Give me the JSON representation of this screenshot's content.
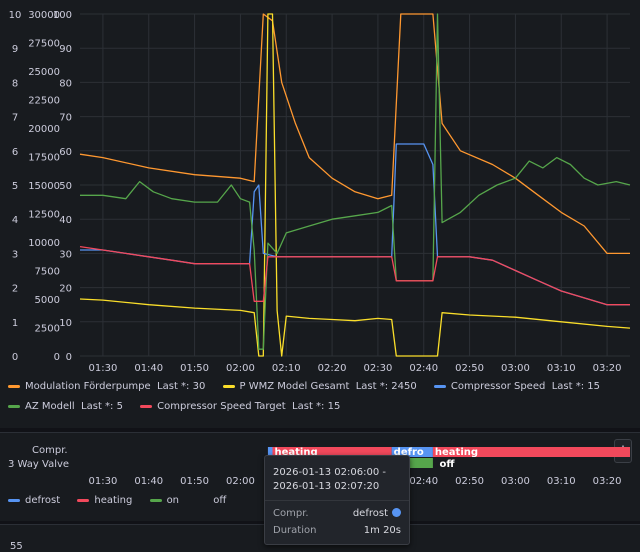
{
  "colors": {
    "orange": "#ff9830",
    "yellow": "#fade2a",
    "blue": "#5794f2",
    "green": "#56a64b",
    "red": "#f2495c",
    "grid": "#2c3036",
    "panel": "#181b1f"
  },
  "chart_data": [
    {
      "type": "line",
      "title": "",
      "x_ticks": [
        "01:30",
        "01:40",
        "01:50",
        "02:00",
        "02:10",
        "02:20",
        "02:30",
        "02:40",
        "02:50",
        "03:00",
        "03:10",
        "03:20"
      ],
      "xlim": [
        "01:25",
        "03:25"
      ],
      "y_axes": [
        {
          "name": "axis_small",
          "ticks": [
            0,
            1,
            2,
            3,
            4,
            5,
            6,
            7,
            8,
            9,
            10
          ],
          "ylim": [
            0,
            10
          ]
        },
        {
          "name": "axis_power",
          "ticks": [
            0,
            2500,
            5000,
            7500,
            10000,
            12500,
            15000,
            17500,
            20000,
            22500,
            25000,
            27500,
            30000
          ],
          "ylim": [
            0,
            30000
          ]
        },
        {
          "name": "axis_percent",
          "ticks": [
            0,
            10,
            20,
            30,
            40,
            50,
            60,
            70,
            80,
            90,
            100
          ],
          "ylim": [
            0,
            100
          ]
        }
      ],
      "grid": true,
      "legend_position": "bottom",
      "series": [
        {
          "name": "Modulation Förderpumpe",
          "legend_value": "Last *: 30",
          "color": "#ff9830",
          "axis": "axis_percent",
          "points": [
            [
              "01:25",
              59
            ],
            [
              "01:30",
              58
            ],
            [
              "01:40",
              55
            ],
            [
              "01:50",
              53
            ],
            [
              "02:00",
              52
            ],
            [
              "02:03",
              51
            ],
            [
              "02:05",
              100
            ],
            [
              "02:07",
              98
            ],
            [
              "02:09",
              80
            ],
            [
              "02:12",
              68
            ],
            [
              "02:15",
              58
            ],
            [
              "02:20",
              52
            ],
            [
              "02:25",
              48
            ],
            [
              "02:30",
              46
            ],
            [
              "02:33",
              47
            ],
            [
              "02:35",
              100
            ],
            [
              "02:42",
              100
            ],
            [
              "02:44",
              68
            ],
            [
              "02:48",
              60
            ],
            [
              "02:55",
              56
            ],
            [
              "03:00",
              52
            ],
            [
              "03:05",
              47
            ],
            [
              "03:10",
              42
            ],
            [
              "03:15",
              38
            ],
            [
              "03:20",
              30
            ],
            [
              "03:25",
              30
            ]
          ]
        },
        {
          "name": "P WMZ Model Gesamt",
          "legend_value": "Last *: 2450",
          "color": "#fade2a",
          "axis": "axis_power",
          "points": [
            [
              "01:25",
              5000
            ],
            [
              "01:30",
              4900
            ],
            [
              "01:40",
              4500
            ],
            [
              "01:50",
              4200
            ],
            [
              "02:00",
              4000
            ],
            [
              "02:03",
              3800
            ],
            [
              "02:04",
              0
            ],
            [
              "02:05",
              0
            ],
            [
              "02:06",
              30000
            ],
            [
              "02:07",
              30000
            ],
            [
              "02:08",
              4000
            ],
            [
              "02:09",
              0
            ],
            [
              "02:10",
              3500
            ],
            [
              "02:15",
              3300
            ],
            [
              "02:20",
              3200
            ],
            [
              "02:25",
              3100
            ],
            [
              "02:30",
              3300
            ],
            [
              "02:33",
              3200
            ],
            [
              "02:34",
              0
            ],
            [
              "02:43",
              0
            ],
            [
              "02:44",
              3800
            ],
            [
              "02:50",
              3600
            ],
            [
              "03:00",
              3400
            ],
            [
              "03:10",
              3000
            ],
            [
              "03:20",
              2600
            ],
            [
              "03:25",
              2450
            ]
          ]
        },
        {
          "name": "Compressor Speed",
          "legend_value": "Last *: 15",
          "color": "#5794f2",
          "axis": "axis_percent",
          "points": [
            [
              "01:25",
              31
            ],
            [
              "01:30",
              31
            ],
            [
              "01:35",
              30
            ],
            [
              "01:40",
              29
            ],
            [
              "01:45",
              28
            ],
            [
              "01:50",
              27
            ],
            [
              "01:55",
              27
            ],
            [
              "02:00",
              27
            ],
            [
              "02:02",
              27
            ],
            [
              "02:03",
              48
            ],
            [
              "02:04",
              50
            ],
            [
              "02:05",
              30
            ],
            [
              "02:08",
              29
            ],
            [
              "02:15",
              29
            ],
            [
              "02:20",
              29
            ],
            [
              "02:25",
              29
            ],
            [
              "02:33",
              29
            ],
            [
              "02:34",
              62
            ],
            [
              "02:40",
              62
            ],
            [
              "02:42",
              56
            ],
            [
              "02:43",
              29
            ],
            [
              "02:50",
              29
            ],
            [
              "02:55",
              28
            ],
            [
              "03:00",
              25
            ],
            [
              "03:05",
              22
            ],
            [
              "03:10",
              19
            ],
            [
              "03:15",
              17
            ],
            [
              "03:20",
              15
            ],
            [
              "03:25",
              15
            ]
          ]
        },
        {
          "name": "AZ Modell",
          "legend_value": "Last *: 5",
          "color": "#56a64b",
          "axis": "axis_small",
          "points": [
            [
              "01:25",
              4.7
            ],
            [
              "01:30",
              4.7
            ],
            [
              "01:35",
              4.6
            ],
            [
              "01:38",
              5.1
            ],
            [
              "01:41",
              4.8
            ],
            [
              "01:45",
              4.6
            ],
            [
              "01:50",
              4.5
            ],
            [
              "01:55",
              4.5
            ],
            [
              "01:58",
              5.0
            ],
            [
              "02:00",
              4.6
            ],
            [
              "02:02",
              4.5
            ],
            [
              "02:03",
              3.1
            ],
            [
              "02:04",
              0.2
            ],
            [
              "02:05",
              0.2
            ],
            [
              "02:06",
              3.3
            ],
            [
              "02:08",
              3.0
            ],
            [
              "02:10",
              3.6
            ],
            [
              "02:15",
              3.8
            ],
            [
              "02:20",
              4.0
            ],
            [
              "02:25",
              4.1
            ],
            [
              "02:30",
              4.2
            ],
            [
              "02:33",
              4.4
            ],
            [
              "02:34",
              2.2
            ],
            [
              "02:42",
              2.2
            ],
            [
              "02:43",
              10
            ],
            [
              "02:44",
              3.9
            ],
            [
              "02:48",
              4.2
            ],
            [
              "02:52",
              4.7
            ],
            [
              "02:56",
              5.0
            ],
            [
              "03:00",
              5.2
            ],
            [
              "03:03",
              5.7
            ],
            [
              "03:06",
              5.5
            ],
            [
              "03:09",
              5.8
            ],
            [
              "03:12",
              5.6
            ],
            [
              "03:15",
              5.2
            ],
            [
              "03:18",
              5.0
            ],
            [
              "03:22",
              5.1
            ],
            [
              "03:25",
              5.0
            ]
          ]
        },
        {
          "name": "Compressor Speed Target",
          "legend_value": "Last *: 15",
          "color": "#f2495c",
          "axis": "axis_percent",
          "points": [
            [
              "01:25",
              32
            ],
            [
              "01:30",
              31
            ],
            [
              "01:35",
              30
            ],
            [
              "01:40",
              29
            ],
            [
              "01:45",
              28
            ],
            [
              "01:50",
              27
            ],
            [
              "01:55",
              27
            ],
            [
              "02:00",
              27
            ],
            [
              "02:02",
              27
            ],
            [
              "02:03",
              16
            ],
            [
              "02:05",
              16
            ],
            [
              "02:06",
              29
            ],
            [
              "02:15",
              29
            ],
            [
              "02:20",
              29
            ],
            [
              "02:25",
              29
            ],
            [
              "02:33",
              29
            ],
            [
              "02:34",
              22
            ],
            [
              "02:42",
              22
            ],
            [
              "02:43",
              29
            ],
            [
              "02:50",
              29
            ],
            [
              "02:55",
              28
            ],
            [
              "03:00",
              25
            ],
            [
              "03:05",
              22
            ],
            [
              "03:10",
              19
            ],
            [
              "03:15",
              17
            ],
            [
              "03:20",
              15
            ],
            [
              "03:25",
              15
            ]
          ]
        }
      ]
    },
    {
      "type": "state-timeline",
      "title": "",
      "rows": [
        "Compr.",
        "3 Way Valve"
      ],
      "x_ticks": [
        "01:30",
        "01:40",
        "01:50",
        "02:00",
        "02:10",
        "02:20",
        "02:30",
        "02:40",
        "02:50",
        "03:00",
        "03:10",
        "03:20"
      ],
      "states": [
        {
          "row": "Compr.",
          "start": "02:06",
          "end": "02:07",
          "state": "defrost"
        },
        {
          "row": "Compr.",
          "start": "02:07",
          "end": "02:33",
          "state": "heating"
        },
        {
          "row": "Compr.",
          "start": "02:33",
          "end": "02:42",
          "state": "defrost"
        },
        {
          "row": "Compr.",
          "start": "02:42",
          "end": "03:25",
          "state": "heating"
        },
        {
          "row": "3 Way Valve",
          "start": "02:33",
          "end": "02:42",
          "state": "on"
        },
        {
          "row": "3 Way Valve",
          "start": "02:42",
          "end": "02:44",
          "state": "off"
        }
      ],
      "visible_labels": [
        {
          "text": "heating",
          "at": "02:07"
        },
        {
          "text": "defro",
          "at": "02:33"
        },
        {
          "text": "heating",
          "at": "02:42"
        },
        {
          "text": "off",
          "at": "02:43"
        }
      ],
      "legend": [
        {
          "name": "defrost",
          "color": "#5794f2"
        },
        {
          "name": "heating",
          "color": "#f2495c"
        },
        {
          "name": "on",
          "color": "#56a64b"
        },
        {
          "name": "off",
          "color": ""
        }
      ]
    }
  ],
  "state_panel": {
    "row1_label": "Compr.",
    "row2_label": "3 Way Valve",
    "menu_icon": "⋮"
  },
  "tooltip": {
    "time_line1": "2026-01-13 02:06:00 -",
    "time_line2": "2026-01-13 02:07:20",
    "field_label": "Compr.",
    "field_value": "defrost",
    "duration_label": "Duration",
    "duration_value": "1m 20s"
  },
  "bottom_panel": {
    "axis_tick": "55"
  }
}
